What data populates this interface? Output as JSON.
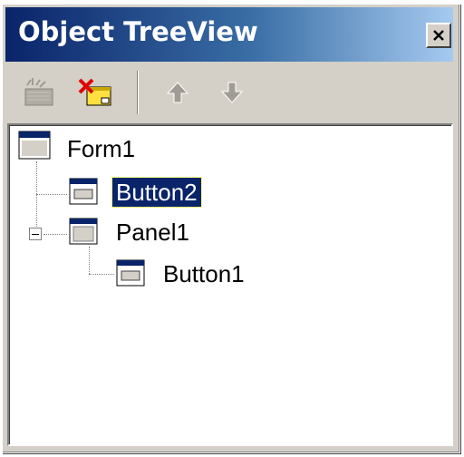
{
  "window": {
    "title": "Object TreeView",
    "close_icon": "close-icon"
  },
  "toolbar": {
    "buttons": [
      {
        "name": "new-object-icon",
        "enabled": false
      },
      {
        "name": "delete-object-icon",
        "enabled": true
      },
      {
        "name": "move-up-icon",
        "enabled": false
      },
      {
        "name": "move-down-icon",
        "enabled": false
      }
    ]
  },
  "tree": {
    "nodes": [
      {
        "label": "Form1",
        "level": 0,
        "selected": false,
        "type": "form"
      },
      {
        "label": "Button2",
        "level": 1,
        "selected": true,
        "type": "button"
      },
      {
        "label": "Panel1",
        "level": 1,
        "selected": false,
        "expanded": true,
        "type": "panel"
      },
      {
        "label": "Button1",
        "level": 2,
        "selected": false,
        "type": "button"
      }
    ]
  },
  "colors": {
    "titlebar_start": "#0a246a",
    "titlebar_end": "#a6caf0",
    "selection": "#0a246a",
    "face": "#d4d0c8"
  }
}
